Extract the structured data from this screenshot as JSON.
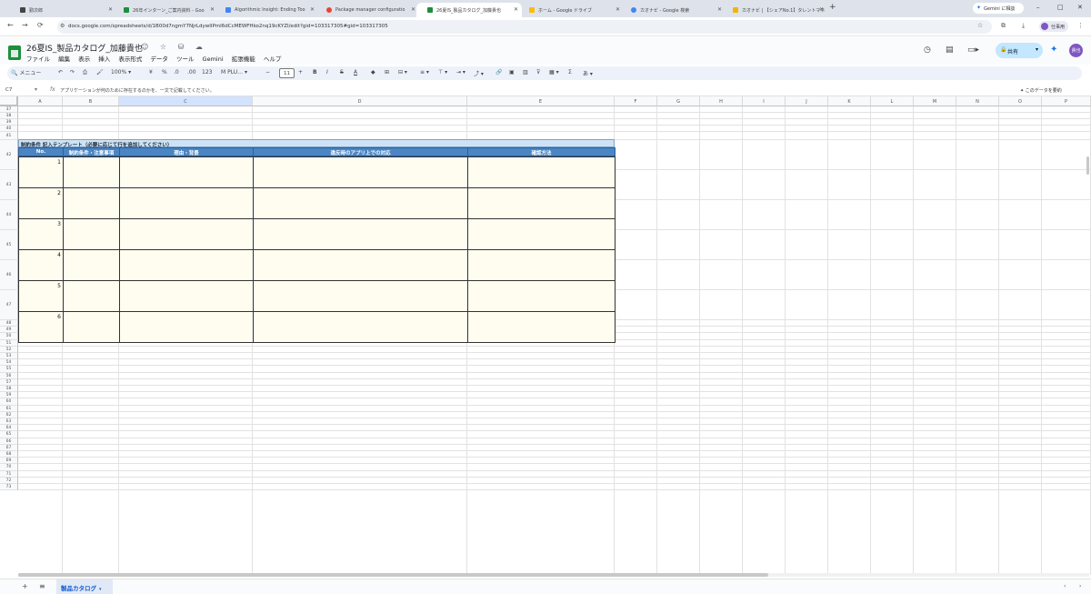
{
  "browser": {
    "tabs": [
      {
        "label": "勤次郎",
        "color": "#444444"
      },
      {
        "label": "26年インターン_ご案内資料 - Goo",
        "color": "#1e8e3e"
      },
      {
        "label": "Algorithmic Insight: Ending Too",
        "color": "#4285f4"
      },
      {
        "label": "Package manager configuratio",
        "color": "#ea4335"
      },
      {
        "label": "26夏IS_製品カタログ_加藤貴也",
        "color": "#1e8e3e"
      },
      {
        "label": "ホーム - Google ドライブ",
        "color": "#fbbc04"
      },
      {
        "label": "カオナビ - Google 検索",
        "color": "#4285f4"
      },
      {
        "label": "カオナビ | 【シェアNo.1】タレントマネ",
        "color": "#f4b400"
      }
    ],
    "new_tab": "+",
    "gemini_chip": "Gemini に相談",
    "window_controls": {
      "minimize": "–",
      "maximize": "□",
      "close": "✕"
    },
    "url": "docs.google.com/spreadsheets/d/1B00d7ngmY7NjrLdywIIPmI6dCcMEWFHko2nq19cKYZI/edit?gid=103317305#gid=103317305",
    "profile_label": "仕事用"
  },
  "doc": {
    "title": "26夏IS_製品カタログ_加藤貴也",
    "title_icons": "☺ ☆ ⛁ ☁",
    "menu": [
      "ファイル",
      "編集",
      "表示",
      "挿入",
      "表示形式",
      "データ",
      "ツール",
      "Gemini",
      "拡張機能",
      "ヘルプ"
    ],
    "share_label": "共有",
    "account_initials": "貴也"
  },
  "toolbar": {
    "search_label": "メニュー",
    "zoom": "100%",
    "currency": "¥",
    "percent": "%",
    "decimal_dec": ".0",
    "decimal_inc": ".00",
    "number_format": "123",
    "font": "M PLU…",
    "font_size": "11",
    "minus": "−",
    "plus": "+",
    "bold": "B",
    "italic": "I",
    "strike": "S",
    "text_color": "A"
  },
  "formula_bar": {
    "cell_ref": "C7",
    "fx": "fx",
    "content": "アプリケーションが何のために存在するのかを、一文で記載してください。",
    "explain": "このデータを要約"
  },
  "grid": {
    "columns": [
      "A",
      "B",
      "C",
      "D",
      "E",
      "F",
      "G",
      "H",
      "I",
      "J",
      "K",
      "L",
      "M",
      "N",
      "O",
      "P"
    ],
    "selected_column": "C",
    "rows": [
      "37",
      "38",
      "39",
      "40",
      "41",
      "42",
      "43",
      "44",
      "45",
      "46",
      "47",
      "48",
      "49",
      "50",
      "51",
      "52",
      "53",
      "54",
      "55",
      "56",
      "57",
      "58",
      "59",
      "60",
      "61",
      "62",
      "63",
      "64",
      "65",
      "66",
      "67",
      "68",
      "69",
      "70",
      "71",
      "72",
      "73"
    ],
    "section_title": "制約条件 記入テンプレート（必要に応じて行を追加してください）",
    "headers": [
      "No.",
      "制約条件・注意事項",
      "理由・背景",
      "違反時のアプリ上での対応",
      "確認方法"
    ],
    "numbers": [
      "1",
      "2",
      "3",
      "4",
      "5",
      "6"
    ],
    "header_color": "#4a86c5",
    "title_color": "#cfe2f3",
    "cell_color": "#fffdf0"
  },
  "sheets": {
    "active_tab": "製品カタログ",
    "add": "+",
    "list": "≡"
  }
}
